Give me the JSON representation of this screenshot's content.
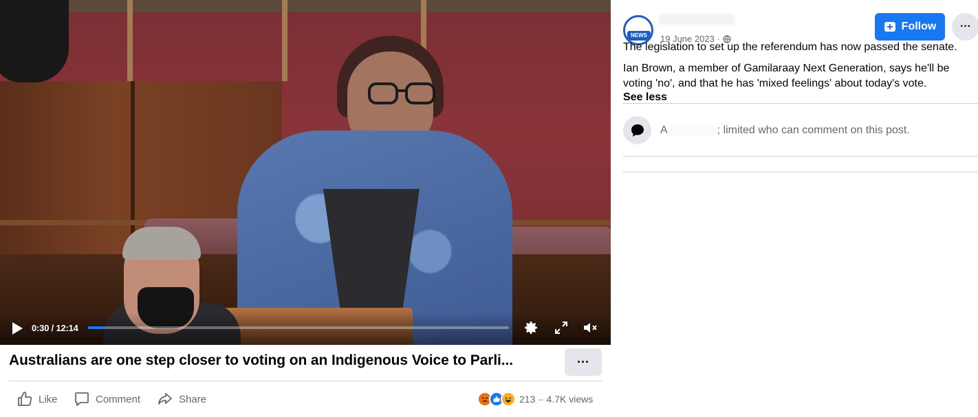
{
  "video": {
    "current_time": "0:30",
    "duration": "12:14",
    "time_display": "0:30 / 12:14",
    "progress_fraction": 0.041,
    "progress_color": "#1877f2"
  },
  "post": {
    "title": "Australians are one step closer to voting on an Indigenous Voice to Parli...",
    "more_label": "···",
    "actions": {
      "like": "Like",
      "comment": "Comment",
      "share": "Share"
    },
    "reactions": {
      "count": "213 ·",
      "types": [
        "angry",
        "like",
        "haha"
      ]
    },
    "views": "· 4.7K views"
  },
  "side": {
    "avatar_badge": "NEWS",
    "date": "19 June 2023 ·",
    "follow_label": "Follow",
    "more_label": "···",
    "paragraph1": "The legislation to set up the referendum has now passed the senate.",
    "paragraph2_line1": "Ian Brown, a member of Gamilaraay Next Generation, says he'll be",
    "paragraph2_line2": "voting 'no', and that he has 'mixed feelings' about today's vote.",
    "see_less": "See less",
    "comment_limit_prefix": "A",
    "comment_limit": "; limited who can comment on this post."
  },
  "colors": {
    "brand_blue": "#1877f2",
    "secondary_text": "#65676b",
    "button_gray": "#e4e6eb"
  }
}
